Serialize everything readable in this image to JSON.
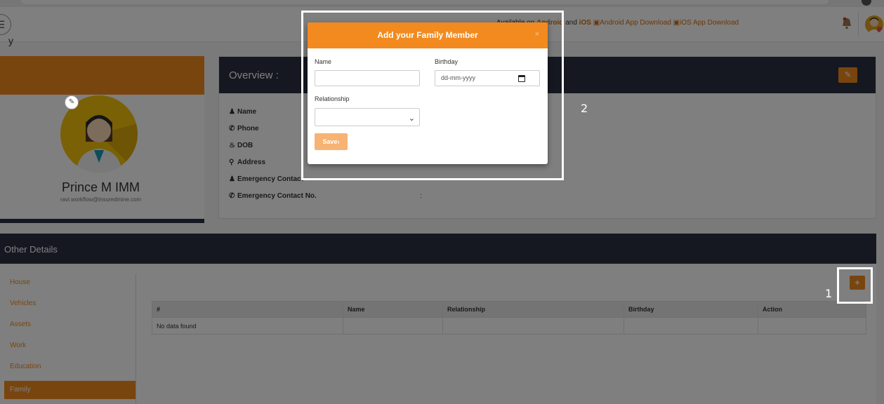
{
  "header": {
    "menu_icon": "hamburger-icon",
    "app_links": {
      "prefix": "Available on",
      "android": "Android",
      "and": "and",
      "ios": "iOS",
      "android_img_alt": "Android App Download",
      "ios_img_alt": "iOS App Download"
    },
    "bell_icon": "bell-icon",
    "avatar_icon": "user-avatar-icon"
  },
  "page_title_fragment": "y",
  "profile": {
    "name": "Prince M IMM",
    "email": "ravi.workflow@insuredmine.com",
    "edit_icon": "pencil-icon"
  },
  "overview": {
    "title": "Overview :",
    "edit_icon": "pencil-icon",
    "rows": [
      {
        "icon": "user-icon",
        "label": "Name"
      },
      {
        "icon": "phone-icon",
        "label": "Phone"
      },
      {
        "icon": "birthday-cake-icon",
        "label": "DOB"
      },
      {
        "icon": "map-marker-icon",
        "label": "Address"
      },
      {
        "icon": "user-icon",
        "label": "Emergency Contact"
      },
      {
        "icon": "phone-icon",
        "label": "Emergency Contact No.",
        "colon": ":"
      }
    ]
  },
  "other_details": {
    "title": "Other Details",
    "nav": [
      "House",
      "Vehicles",
      "Assets",
      "Work",
      "Education",
      "Family"
    ],
    "active_nav": "Family",
    "add_button_icon": "plus-icon",
    "table": {
      "columns": [
        "#",
        "Name",
        "Relationship",
        "Birthday",
        "Action"
      ],
      "empty_text": "No data found"
    }
  },
  "modal": {
    "title": "Add your Family Member",
    "close": "×",
    "name_label": "Name",
    "name_value": "",
    "birthday_label": "Birthday",
    "birthday_placeholder": "dd-mm-yyyy",
    "relationship_label": "Relationship",
    "relationship_value": "",
    "save_label": "Save",
    "save_icon": "chevron-right-icon"
  },
  "annotations": {
    "callout_1": "1",
    "callout_2": "2"
  },
  "colors": {
    "accent": "#f28a1f",
    "dark_header": "#2b3140",
    "overlay": "rgba(0,0,0,0.5)"
  }
}
